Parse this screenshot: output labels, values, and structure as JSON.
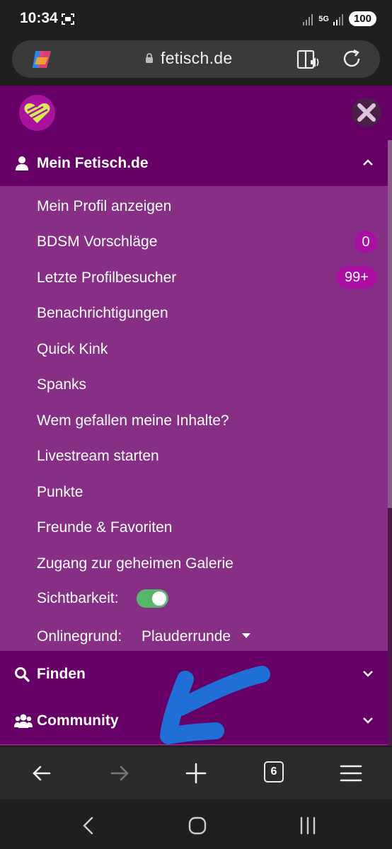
{
  "status_bar": {
    "time": "10:34",
    "network": "5G",
    "battery": "100",
    "icons": [
      "screen-record-icon",
      "signal-icon",
      "battery-icon"
    ]
  },
  "browser": {
    "url": "fetisch.de",
    "icons": [
      "copilot-icon",
      "lock-icon",
      "reader-mode-icon",
      "reload-icon"
    ]
  },
  "menu": {
    "sections": [
      {
        "label": "Mein Fetisch.de",
        "icon": "user-icon",
        "expanded": true
      },
      {
        "label": "Finden",
        "icon": "search-icon",
        "expanded": false
      },
      {
        "label": "Community",
        "icon": "users-icon",
        "expanded": false
      }
    ],
    "items": [
      {
        "label": "Mein Profil anzeigen"
      },
      {
        "label": "BDSM Vorschläge",
        "badge": "0"
      },
      {
        "label": "Letzte Profilbesucher",
        "badge": "99+"
      },
      {
        "label": "Benachrichtigungen"
      },
      {
        "label": "Quick Kink"
      },
      {
        "label": "Spanks"
      },
      {
        "label": "Wem gefallen meine Inhalte?"
      },
      {
        "label": "Livestream starten"
      },
      {
        "label": "Punkte"
      },
      {
        "label": "Freunde & Favoriten"
      },
      {
        "label": "Zugang zur geheimen Galerie"
      }
    ],
    "visibility": {
      "label": "Sichtbarkeit:",
      "on": true
    },
    "online_reason": {
      "label": "Onlinegrund:",
      "value": "Plauderrunde"
    }
  },
  "toolbar": {
    "tab_count": "6",
    "icons": [
      "back-icon",
      "forward-icon",
      "new-tab-icon",
      "tabs-icon",
      "menu-icon"
    ]
  },
  "system_nav": {
    "icons": [
      "nav-back-icon",
      "home-icon",
      "recents-icon"
    ]
  },
  "colors": {
    "brand_purple": "#660066",
    "submenu_purple": "#862f85",
    "badge": "#a90fa3",
    "toggle_on": "#56b66c",
    "annotation_blue": "#1f6fd6"
  }
}
